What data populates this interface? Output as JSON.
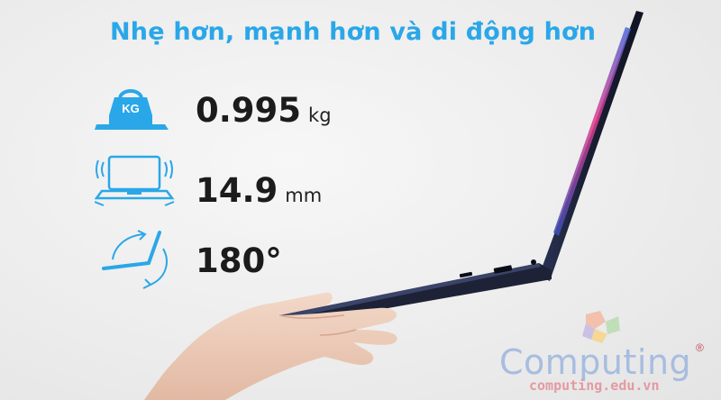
{
  "headline": "Nhẹ hơn, mạnh hơn và di động hơn",
  "specs": [
    {
      "icon": "laptop-weight-icon",
      "icon_text": "KG",
      "value": "0.995",
      "unit": "kg"
    },
    {
      "icon": "laptop-thin-icon",
      "value": "14.9",
      "unit": "mm"
    },
    {
      "icon": "hinge-180-icon",
      "value": "180°"
    }
  ],
  "watermark": {
    "name": "Computing",
    "url": "computing.edu.vn",
    "registered": "®"
  },
  "colors": {
    "accent": "#2aa7e8",
    "laptop": "#1d2236",
    "screen_glow": "#e23a8c",
    "logo_blue": "#a7bde0",
    "logo_red": "#e39aa3"
  }
}
